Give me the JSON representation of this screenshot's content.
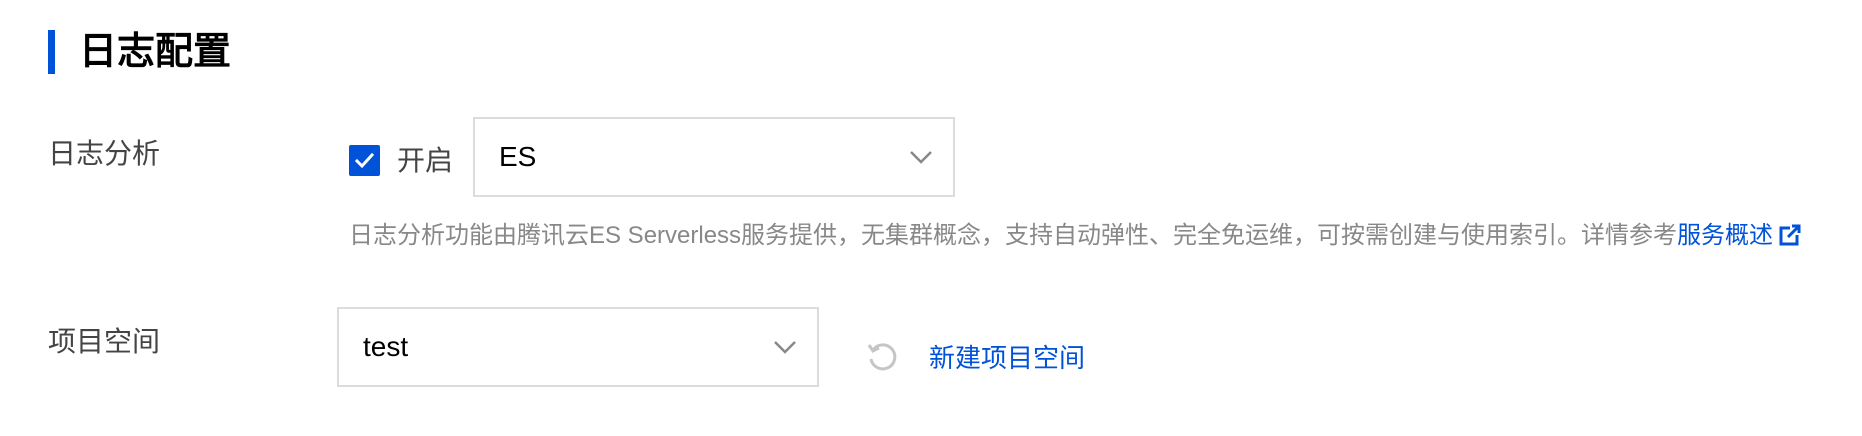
{
  "section": {
    "title": "日志配置"
  },
  "log_analysis": {
    "label": "日志分析",
    "checkbox_label": "开启",
    "checked": true,
    "engine_select": {
      "value": "ES"
    },
    "hint": {
      "text": "日志分析功能由腾讯云ES Serverless服务提供，无集群概念，支持自动弹性、完全免运维，可按需创建与使用索引。详情参考",
      "link_text": "服务概述",
      "link_icon": "external-link-icon"
    }
  },
  "project_space": {
    "label": "项目空间",
    "select": {
      "value": "test"
    },
    "refresh_icon": "refresh-icon",
    "new_link": "新建项目空间"
  },
  "colors": {
    "accent": "#0052d9",
    "label": "#444444",
    "hint": "#888888",
    "border": "#dcdcdc",
    "icon_disabled": "#c5c5c5"
  }
}
